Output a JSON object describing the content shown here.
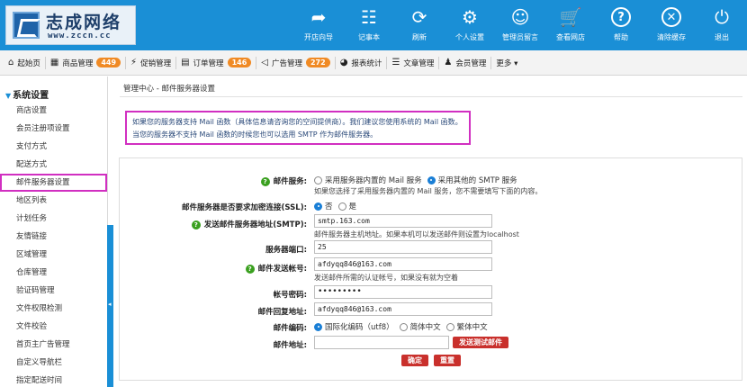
{
  "logo": {
    "name": "志成网络",
    "url": "www.zccn.cc"
  },
  "toolbar": [
    {
      "icon": "share-arrow-icon",
      "glyph": "➦",
      "label": "开店向导"
    },
    {
      "icon": "notebook-icon",
      "glyph": "☷",
      "label": "记事本"
    },
    {
      "icon": "refresh-icon",
      "glyph": "⟳",
      "label": "刷新"
    },
    {
      "icon": "gear-icon",
      "glyph": "⚙",
      "label": "个人设置"
    },
    {
      "icon": "smiley-icon",
      "glyph": "☺",
      "label": "管理员留言"
    },
    {
      "icon": "cart-icon",
      "glyph": "🛒",
      "label": "查看网店"
    },
    {
      "icon": "help-icon",
      "glyph": "?",
      "label": "帮助"
    },
    {
      "icon": "clear-cache-icon",
      "glyph": "✕",
      "label": "清除缓存"
    },
    {
      "icon": "power-icon",
      "glyph": "⏻",
      "label": "退出"
    }
  ],
  "nav": [
    {
      "icon": "home-icon",
      "glyph": "⌂",
      "label": "起始页",
      "badge": ""
    },
    {
      "icon": "goods-icon",
      "glyph": "▦",
      "label": "商品管理",
      "badge": "449"
    },
    {
      "icon": "promo-icon",
      "glyph": "⚡",
      "label": "促销管理",
      "badge": ""
    },
    {
      "icon": "order-icon",
      "glyph": "▤",
      "label": "订单管理",
      "badge": "146"
    },
    {
      "icon": "ad-icon",
      "glyph": "◁",
      "label": "广告管理",
      "badge": "272"
    },
    {
      "icon": "stats-icon",
      "glyph": "◕",
      "label": "报表统计",
      "badge": ""
    },
    {
      "icon": "article-icon",
      "glyph": "☰",
      "label": "文章管理",
      "badge": ""
    },
    {
      "icon": "member-icon",
      "glyph": "♟",
      "label": "会员管理",
      "badge": ""
    },
    {
      "icon": "more-icon",
      "glyph": "",
      "label": "更多 ▾",
      "badge": ""
    }
  ],
  "sidebar": {
    "title": "系统设置",
    "items": [
      "商店设置",
      "会员注册项设置",
      "支付方式",
      "配送方式",
      "邮件服务器设置",
      "地区列表",
      "计划任务",
      "友情链接",
      "区域管理",
      "仓库管理",
      "验证码管理",
      "文件权限检测",
      "文件校验",
      "首页主广告管理",
      "自定义导航栏",
      "指定配送时间"
    ],
    "active_index": 4
  },
  "breadcrumb": "管理中心  -  邮件服务器设置",
  "notice": {
    "line1": "如果您的服务器支持 Mail 函数（具体信息请咨询您的空间提供商）。我们建议您使用系统的 Mail 函数。",
    "line2": "当您的服务器不支持 Mail 函数的时候您也可以选用 SMTP 作为邮件服务器。"
  },
  "form": {
    "mail_service": {
      "label": "邮件服务:",
      "opt1": "采用服务器内置的 Mail 服务",
      "opt2": "采用其他的 SMTP 服务",
      "selected": 2,
      "hint": "如果您选择了采用服务器内置的 Mail 服务，您不需要填写下面的内容。"
    },
    "ssl": {
      "label": "邮件服务器是否要求加密连接(SSL):",
      "opt_no": "否",
      "opt_yes": "是",
      "selected": "no"
    },
    "smtp_host": {
      "label": "发送邮件服务器地址(SMTP):",
      "value": "smtp.163.com",
      "hint": "邮件服务器主机地址。如果本机可以发送邮件则设置为localhost"
    },
    "port": {
      "label": "服务器端口:",
      "value": "25"
    },
    "account": {
      "label": "邮件发送帐号:",
      "value": "afdyqq846@163.com",
      "hint": "发送邮件所需的认证帐号，如果没有就为空着"
    },
    "password": {
      "label": "帐号密码:",
      "value": "•••••••••"
    },
    "reply_to": {
      "label": "邮件回复地址:",
      "value": "afdyqq846@163.com"
    },
    "charset": {
      "label": "邮件编码:",
      "opt1": "国际化编码（utf8）",
      "opt2": "简体中文",
      "opt3": "繁体中文",
      "selected": 1
    },
    "test_addr": {
      "label": "邮件地址:",
      "value": "",
      "button": "发送测试邮件"
    },
    "submit": "确定",
    "reset": "重置"
  },
  "colors": {
    "brand": "#1a8fd6",
    "highlight": "#d12fc1",
    "badge": "#f08a24",
    "danger": "#c9302c",
    "help": "#3aa01f"
  }
}
